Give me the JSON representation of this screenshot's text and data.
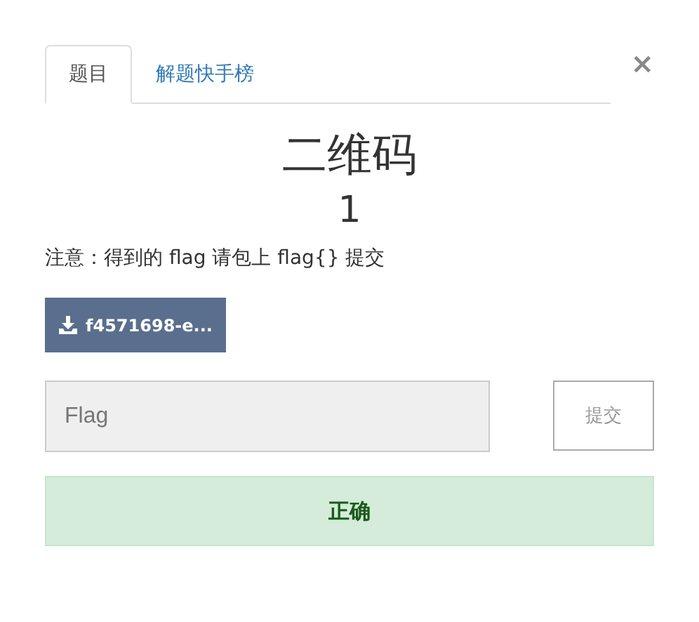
{
  "tabs": [
    {
      "label": "题目",
      "selected": true
    },
    {
      "label": "解题快手榜",
      "selected": false
    }
  ],
  "close": "×",
  "challenge": {
    "title": "二维码",
    "points": "1",
    "note": "注意：得到的 flag 请包上 flag{} 提交",
    "file": "f4571698-e..."
  },
  "flag_input": {
    "placeholder": "Flag"
  },
  "submit_button": "提交",
  "result": {
    "kind": "success",
    "text": "正确"
  }
}
